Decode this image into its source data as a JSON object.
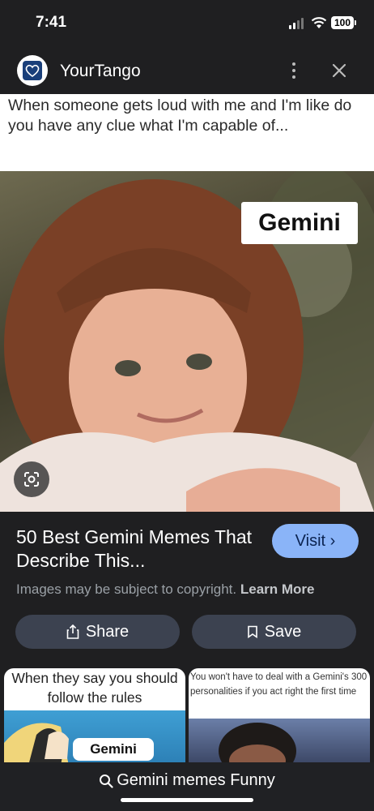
{
  "status": {
    "time": "7:41",
    "battery": "100"
  },
  "header": {
    "site_name": "YourTango"
  },
  "image": {
    "caption": "When someone gets loud with me and I'm like do you have any clue what I'm capable of...",
    "label": "Gemini"
  },
  "result": {
    "title": "50 Best Gemini Memes That Describe This...",
    "visit_label": "Visit ›",
    "copyright_text": "Images may be subject to copyright.",
    "learn_more": "Learn More",
    "share_label": "Share",
    "save_label": "Save"
  },
  "related": [
    {
      "caption": "When they say you should follow the rules",
      "label": "Gemini"
    },
    {
      "caption": "You won't have to deal with a Gemini's 300 personalities if you act right the first time"
    }
  ],
  "bottom": {
    "search_query": "Gemini memes Funny"
  }
}
